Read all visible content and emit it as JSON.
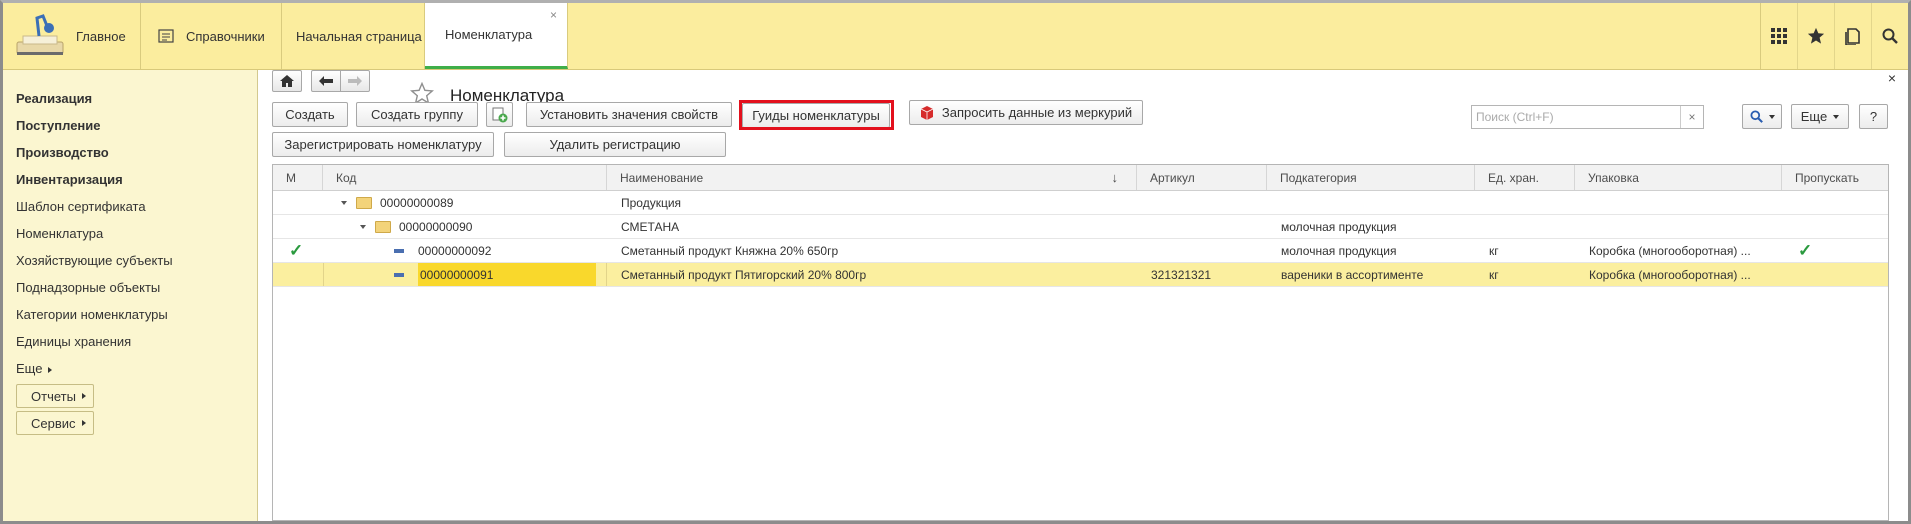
{
  "top_tabs": {
    "home": "Главное",
    "references": "Справочники",
    "start_page": "Начальная страница",
    "nomenclature": "Номенклатура",
    "close_glyph": "×"
  },
  "sidebar": {
    "items": [
      {
        "label": "Реализация",
        "bold": true
      },
      {
        "label": "Поступление",
        "bold": true
      },
      {
        "label": "Производство",
        "bold": true
      },
      {
        "label": "Инвентаризация",
        "bold": true
      },
      {
        "label": "Шаблон сертификата",
        "bold": false
      },
      {
        "label": "Номенклатура",
        "bold": false
      },
      {
        "label": "Хозяйствующие субъекты",
        "bold": false
      },
      {
        "label": "Поднадзорные объекты",
        "bold": false
      },
      {
        "label": "Категории номенклатуры",
        "bold": false
      },
      {
        "label": "Единицы хранения",
        "bold": false
      },
      {
        "label": "Еще",
        "bold": false
      }
    ],
    "reports_btn": "Отчеты",
    "service_btn": "Сервис"
  },
  "form": {
    "title": "Номенклатура",
    "close_glyph": "×",
    "toolbar": {
      "create": "Создать",
      "create_group": "Создать группу",
      "set_props": "Установить значения свойств",
      "guides": "Гуиды номенклатуры",
      "request_mercury": "Запросить данные из меркурий",
      "register": "Зарегистрировать номенклатуру",
      "unregister": "Удалить регистрацию",
      "more": "Еще",
      "help": "?"
    },
    "search": {
      "placeholder": "Поиск (Ctrl+F)",
      "clear": "×"
    }
  },
  "table": {
    "columns": [
      "М",
      "Код",
      "Наименование",
      "Артикул",
      "Подкатегория",
      "Ед. хран.",
      "Упаковка",
      "Пропускать"
    ],
    "sort_indicator": "↓",
    "rows": [
      {
        "kind": "group",
        "level": 0,
        "mark": "",
        "code": "00000000089",
        "name": "Продукция",
        "article": "",
        "subcategory": "",
        "unit": "",
        "pack": "",
        "skip": ""
      },
      {
        "kind": "group",
        "level": 1,
        "mark": "",
        "code": "00000000090",
        "name": "СМЕТАНА",
        "article": "",
        "subcategory": "молочная продукция",
        "unit": "",
        "pack": "",
        "skip": ""
      },
      {
        "kind": "item",
        "level": 2,
        "mark": "✓",
        "code": "00000000092",
        "name": "Сметанный продукт Княжна 20% 650гр",
        "article": "",
        "subcategory": "молочная продукция",
        "unit": "кг",
        "pack": "Коробка (многооборотная) ...",
        "skip": "✓"
      },
      {
        "kind": "item",
        "level": 2,
        "mark": "",
        "code": "00000000091",
        "name": "Сметанный продукт Пятигорский 20% 800гр",
        "article": "321321321",
        "subcategory": "вареники в ассортименте",
        "unit": "кг",
        "pack": "Коробка (многооборотная) ...",
        "skip": "",
        "selected": true
      }
    ]
  },
  "colors": {
    "accent_yellow": "#fbed9e",
    "sidebar_bg": "#fbf6d0",
    "highlight_red": "#e3101d",
    "check_green": "#2a9a3e",
    "selected_row": "#fbef9f",
    "selected_cell": "#f9d82c"
  }
}
